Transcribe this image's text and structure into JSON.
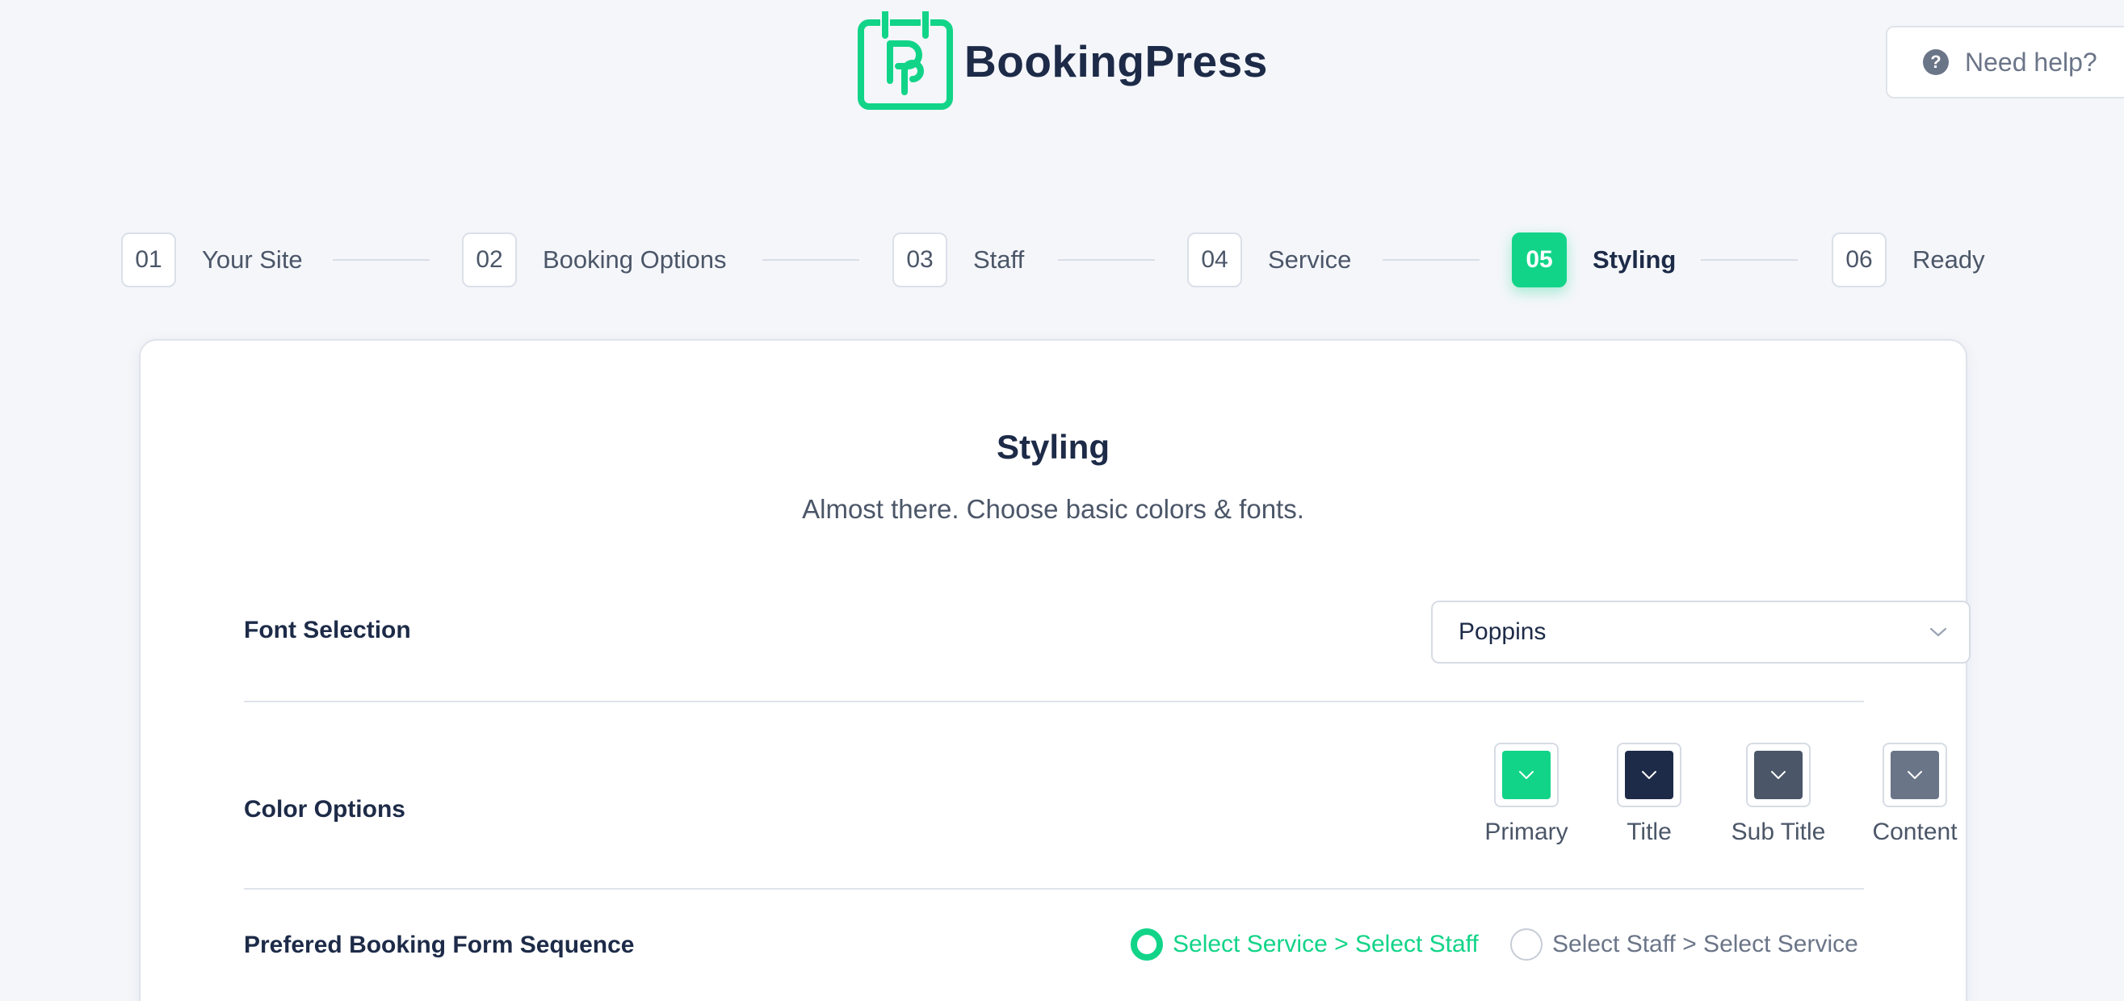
{
  "header": {
    "brand": "BookingPress",
    "help_label": "Need help?",
    "accent_color": "#12d488"
  },
  "stepper": {
    "steps": [
      {
        "number": "01",
        "label": "Your Site"
      },
      {
        "number": "02",
        "label": "Booking Options"
      },
      {
        "number": "03",
        "label": "Staff"
      },
      {
        "number": "04",
        "label": "Service"
      },
      {
        "number": "05",
        "label": "Styling",
        "active": true
      },
      {
        "number": "06",
        "label": "Ready"
      }
    ]
  },
  "card": {
    "title": "Styling",
    "subtitle": "Almost there. Choose basic colors & fonts.",
    "font_selection": {
      "label": "Font Selection",
      "value": "Poppins"
    },
    "color_options": {
      "label": "Color Options",
      "swatches": [
        {
          "label": "Primary",
          "color": "#12d488"
        },
        {
          "label": "Title",
          "color": "#1d2b48"
        },
        {
          "label": "Sub Title",
          "color": "#4b5668"
        },
        {
          "label": "Content",
          "color": "#6b7588"
        }
      ]
    },
    "sequence": {
      "label": "Prefered Booking Form Sequence",
      "options": [
        {
          "label": "Select Service > Select Staff",
          "checked": true
        },
        {
          "label": "Select Staff > Select Service",
          "checked": false
        }
      ]
    }
  }
}
